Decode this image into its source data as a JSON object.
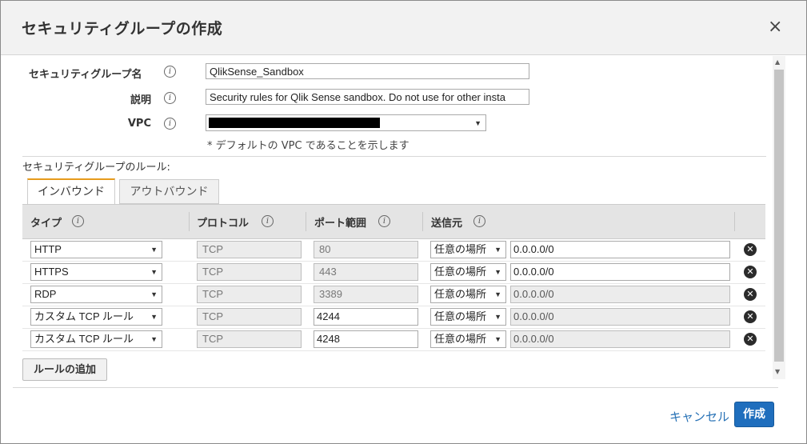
{
  "dialog": {
    "title": "セキュリティグループの作成",
    "close_icon": "×"
  },
  "form": {
    "name_label": "セキュリティグループ名",
    "name_value": "QlikSense_Sandbox",
    "desc_label": "説明",
    "desc_value": "Security rules for Qlik Sense sandbox. Do not use for other insta",
    "vpc_label": "VPC",
    "vpc_hint": "* デフォルトの VPC であることを示します",
    "info_icon": "i"
  },
  "rules": {
    "section_label": "セキュリティグループのルール:",
    "tabs": [
      {
        "label": "インバウンド",
        "active": true
      },
      {
        "label": "アウトバウンド",
        "active": false
      }
    ],
    "columns": [
      "タイプ",
      "プロトコル",
      "ポート範囲",
      "送信元"
    ],
    "rows": [
      {
        "type": "HTTP",
        "protocol": "TCP",
        "port": "80",
        "source_type": "任意の場所",
        "source": "0.0.0.0/0"
      },
      {
        "type": "HTTPS",
        "protocol": "TCP",
        "port": "443",
        "source_type": "任意の場所",
        "source": "0.0.0.0/0"
      },
      {
        "type": "RDP",
        "protocol": "TCP",
        "port": "3389",
        "source_type": "任意の場所",
        "source": "0.0.0.0/0"
      },
      {
        "type": "カスタム TCP ルール",
        "protocol": "TCP",
        "port": "4244",
        "source_type": "任意の場所",
        "source": "0.0.0.0/0"
      },
      {
        "type": "カスタム TCP ルール",
        "protocol": "TCP",
        "port": "4248",
        "source_type": "任意の場所",
        "source": "0.0.0.0/0"
      }
    ],
    "add_rule_label": "ルールの追加",
    "delete_icon": "✕"
  },
  "footer": {
    "cancel_label": "キャンセル",
    "create_label": "作成"
  }
}
